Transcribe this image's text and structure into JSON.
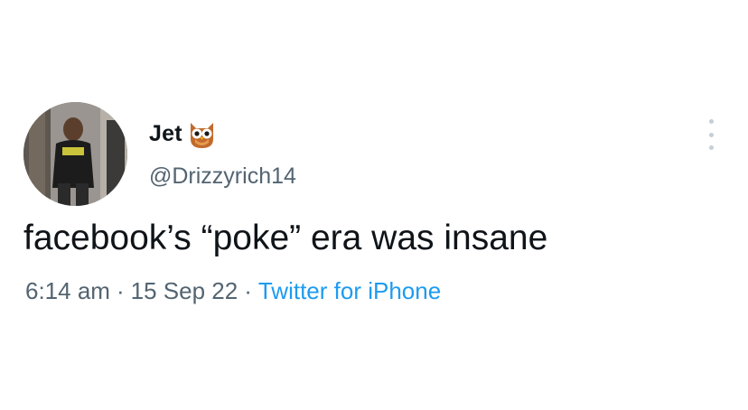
{
  "tweet": {
    "author": {
      "display_name": "Jet",
      "badge_icon": "owl-emoji-icon",
      "handle": "@Drizzyrich14",
      "avatar": "profile-photo"
    },
    "text": "facebook’s “poke” era was insane",
    "meta": {
      "time": "6:14 am",
      "separator": "·",
      "date": "15 Sep 22",
      "source": "Twitter for iPhone"
    },
    "more_icon": "more-vertical-icon"
  },
  "colors": {
    "text": "#0f1419",
    "secondary": "#536471",
    "link": "#1d9bf0",
    "background": "#ffffff"
  }
}
